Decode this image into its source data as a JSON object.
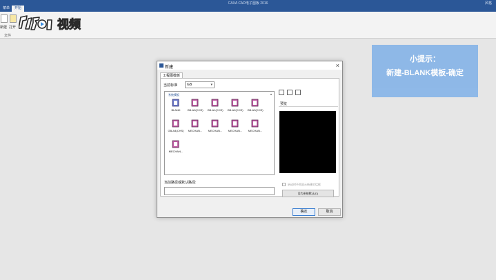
{
  "titlebar": {
    "app_title": "CAXA CAD电子图板 2016",
    "style_label": "风格"
  },
  "ribbon": {
    "tabs": [
      {
        "label": "菜单"
      },
      {
        "label": "开始"
      }
    ],
    "buttons": [
      {
        "label": "新建"
      },
      {
        "label": "打开"
      }
    ],
    "group_label": "文件"
  },
  "logo": {
    "text": "视频"
  },
  "tip": {
    "line1": "小提示：",
    "line2": "新建-BLANK模板-确定"
  },
  "dialog": {
    "title": "新建",
    "tab_label": "工程图模板",
    "current_standard_label": "当前标准",
    "current_standard_value": "GB",
    "system_templates_label": "系统模板",
    "templates": [
      {
        "label": "BLANK"
      },
      {
        "label": "GB-A0(CHS)"
      },
      {
        "label": "GB-A1(CHS)"
      },
      {
        "label": "GB-A2(CHS)"
      },
      {
        "label": "GB-A3(CHS)"
      },
      {
        "label": "GB-A4(CHS)"
      },
      {
        "label": "MECHAN..."
      },
      {
        "label": "MECHAN..."
      },
      {
        "label": "MECHAN..."
      },
      {
        "label": "MECHAN..."
      },
      {
        "label": "MECHAN..."
      }
    ],
    "preview_label": "预览",
    "path_label": "当前路径或默认路径:",
    "path_value": "",
    "checkbox_label": "启动时不再显示新建对话框",
    "set_default_label": "设为系统默认(D)",
    "ok_label": "确定",
    "cancel_label": "取消"
  },
  "colors": {
    "title_bar": "#2b5797",
    "tip_bg": "#8ab6e8",
    "preview_bg": "#000000"
  }
}
